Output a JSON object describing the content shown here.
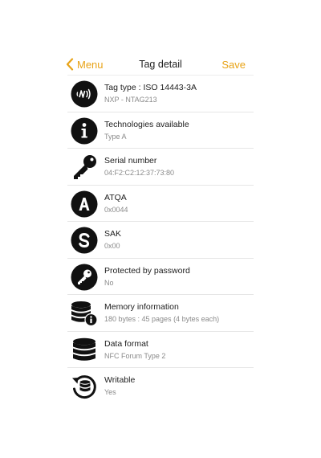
{
  "nav": {
    "back_label": "Menu",
    "title": "Tag detail",
    "save_label": "Save",
    "accent_color": "#e8a317"
  },
  "rows": [
    {
      "icon": "nfc-icon",
      "title": "Tag type : ISO 14443-3A",
      "subtitle": "NXP - NTAG213"
    },
    {
      "icon": "info-icon",
      "title": "Technologies available",
      "subtitle": "Type A"
    },
    {
      "icon": "key-icon",
      "title": "Serial number",
      "subtitle": "04:F2:C2:12:37:73:80"
    },
    {
      "icon": "letter-a-icon",
      "title": "ATQA",
      "subtitle": "0x0044"
    },
    {
      "icon": "letter-s-icon",
      "title": "SAK",
      "subtitle": "0x00"
    },
    {
      "icon": "key-circle-icon",
      "title": "Protected by password",
      "subtitle": "No"
    },
    {
      "icon": "database-info-icon",
      "title": "Memory information",
      "subtitle": "180 bytes : 45 pages (4 bytes each)"
    },
    {
      "icon": "database-icon",
      "title": "Data format",
      "subtitle": "NFC Forum Type 2"
    },
    {
      "icon": "rewrite-icon",
      "title": "Writable",
      "subtitle": "Yes"
    }
  ]
}
